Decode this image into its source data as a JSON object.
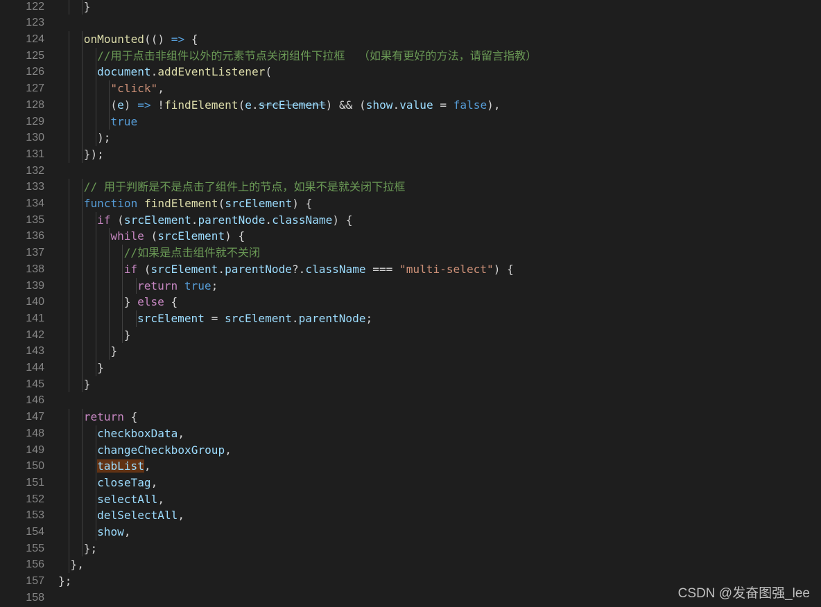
{
  "editor": {
    "watermark": "CSDN @发奋图强_lee",
    "colors": {
      "background": "#1e1e1e",
      "line_number": "#858585",
      "keyword": "#c586c0",
      "storage": "#569cd6",
      "function": "#dcdcaa",
      "variable": "#9cdcfe",
      "string": "#ce9178",
      "comment": "#6a9955",
      "text": "#d4d4d4",
      "highlight": "#613214"
    },
    "lines": [
      {
        "n": "122",
        "indent": 2,
        "tokens": [
          {
            "t": "}",
            "c": "text"
          }
        ]
      },
      {
        "n": "123",
        "indent": 0,
        "tokens": []
      },
      {
        "n": "124",
        "indent": 2,
        "tokens": [
          {
            "t": "onMounted",
            "c": "fn"
          },
          {
            "t": "(() ",
            "c": "text"
          },
          {
            "t": "=>",
            "c": "arrow"
          },
          {
            "t": " {",
            "c": "text"
          }
        ]
      },
      {
        "n": "125",
        "indent": 3,
        "tokens": [
          {
            "t": "//用于点击非组件以外的元素节点关闭组件下拉框  （如果有更好的方法，请留言指教）",
            "c": "cmt"
          }
        ]
      },
      {
        "n": "126",
        "indent": 3,
        "tokens": [
          {
            "t": "document",
            "c": "var"
          },
          {
            "t": ".",
            "c": "text"
          },
          {
            "t": "addEventListener",
            "c": "fn"
          },
          {
            "t": "(",
            "c": "text"
          }
        ]
      },
      {
        "n": "127",
        "indent": 4,
        "tokens": [
          {
            "t": "\"click\"",
            "c": "str"
          },
          {
            "t": ",",
            "c": "text"
          }
        ]
      },
      {
        "n": "128",
        "indent": 4,
        "tokens": [
          {
            "t": "(",
            "c": "text"
          },
          {
            "t": "e",
            "c": "var"
          },
          {
            "t": ") ",
            "c": "text"
          },
          {
            "t": "=>",
            "c": "arrow"
          },
          {
            "t": " !",
            "c": "text"
          },
          {
            "t": "findElement",
            "c": "fn"
          },
          {
            "t": "(",
            "c": "text"
          },
          {
            "t": "e",
            "c": "var"
          },
          {
            "t": ".",
            "c": "text"
          },
          {
            "t": "srcElement",
            "c": "var",
            "deprecated": true
          },
          {
            "t": ") && (",
            "c": "text"
          },
          {
            "t": "show",
            "c": "var"
          },
          {
            "t": ".",
            "c": "text"
          },
          {
            "t": "value",
            "c": "var"
          },
          {
            "t": " = ",
            "c": "text"
          },
          {
            "t": "false",
            "c": "bool"
          },
          {
            "t": "),",
            "c": "text"
          }
        ]
      },
      {
        "n": "129",
        "indent": 4,
        "tokens": [
          {
            "t": "true",
            "c": "bool"
          }
        ]
      },
      {
        "n": "130",
        "indent": 3,
        "tokens": [
          {
            "t": ");",
            "c": "text"
          }
        ]
      },
      {
        "n": "131",
        "indent": 2,
        "tokens": [
          {
            "t": "});",
            "c": "text"
          }
        ]
      },
      {
        "n": "132",
        "indent": 0,
        "tokens": []
      },
      {
        "n": "133",
        "indent": 2,
        "tokens": [
          {
            "t": "// 用于判断是不是点击了组件上的节点，如果不是就关闭下拉框",
            "c": "cmt"
          }
        ]
      },
      {
        "n": "134",
        "indent": 2,
        "tokens": [
          {
            "t": "function",
            "c": "storage"
          },
          {
            "t": " ",
            "c": "text"
          },
          {
            "t": "findElement",
            "c": "fn"
          },
          {
            "t": "(",
            "c": "text"
          },
          {
            "t": "srcElement",
            "c": "var"
          },
          {
            "t": ") {",
            "c": "text"
          }
        ]
      },
      {
        "n": "135",
        "indent": 3,
        "tokens": [
          {
            "t": "if",
            "c": "kw"
          },
          {
            "t": " (",
            "c": "text"
          },
          {
            "t": "srcElement",
            "c": "var"
          },
          {
            "t": ".",
            "c": "text"
          },
          {
            "t": "parentNode",
            "c": "var"
          },
          {
            "t": ".",
            "c": "text"
          },
          {
            "t": "className",
            "c": "var"
          },
          {
            "t": ") {",
            "c": "text"
          }
        ]
      },
      {
        "n": "136",
        "indent": 4,
        "tokens": [
          {
            "t": "while",
            "c": "kw"
          },
          {
            "t": " (",
            "c": "text"
          },
          {
            "t": "srcElement",
            "c": "var"
          },
          {
            "t": ") {",
            "c": "text"
          }
        ]
      },
      {
        "n": "137",
        "indent": 5,
        "tokens": [
          {
            "t": "//如果是点击组件就不关闭",
            "c": "cmt"
          }
        ]
      },
      {
        "n": "138",
        "indent": 5,
        "tokens": [
          {
            "t": "if",
            "c": "kw"
          },
          {
            "t": " (",
            "c": "text"
          },
          {
            "t": "srcElement",
            "c": "var"
          },
          {
            "t": ".",
            "c": "text"
          },
          {
            "t": "parentNode",
            "c": "var"
          },
          {
            "t": "?.",
            "c": "text"
          },
          {
            "t": "className",
            "c": "var"
          },
          {
            "t": " === ",
            "c": "text"
          },
          {
            "t": "\"multi-select\"",
            "c": "str"
          },
          {
            "t": ") {",
            "c": "text"
          }
        ]
      },
      {
        "n": "139",
        "indent": 6,
        "tokens": [
          {
            "t": "return",
            "c": "kw"
          },
          {
            "t": " ",
            "c": "text"
          },
          {
            "t": "true",
            "c": "bool"
          },
          {
            "t": ";",
            "c": "text"
          }
        ]
      },
      {
        "n": "140",
        "indent": 5,
        "tokens": [
          {
            "t": "} ",
            "c": "text"
          },
          {
            "t": "else",
            "c": "kw"
          },
          {
            "t": " {",
            "c": "text"
          }
        ]
      },
      {
        "n": "141",
        "indent": 6,
        "tokens": [
          {
            "t": "srcElement",
            "c": "var"
          },
          {
            "t": " = ",
            "c": "text"
          },
          {
            "t": "srcElement",
            "c": "var"
          },
          {
            "t": ".",
            "c": "text"
          },
          {
            "t": "parentNode",
            "c": "var"
          },
          {
            "t": ";",
            "c": "text"
          }
        ]
      },
      {
        "n": "142",
        "indent": 5,
        "tokens": [
          {
            "t": "}",
            "c": "text"
          }
        ]
      },
      {
        "n": "143",
        "indent": 4,
        "tokens": [
          {
            "t": "}",
            "c": "text"
          }
        ]
      },
      {
        "n": "144",
        "indent": 3,
        "tokens": [
          {
            "t": "}",
            "c": "text"
          }
        ]
      },
      {
        "n": "145",
        "indent": 2,
        "tokens": [
          {
            "t": "}",
            "c": "text"
          }
        ]
      },
      {
        "n": "146",
        "indent": 0,
        "tokens": []
      },
      {
        "n": "147",
        "indent": 2,
        "tokens": [
          {
            "t": "return",
            "c": "kw"
          },
          {
            "t": " {",
            "c": "text"
          }
        ]
      },
      {
        "n": "148",
        "indent": 3,
        "tokens": [
          {
            "t": "checkboxData",
            "c": "var"
          },
          {
            "t": ",",
            "c": "text"
          }
        ]
      },
      {
        "n": "149",
        "indent": 3,
        "tokens": [
          {
            "t": "changeCheckboxGroup",
            "c": "var"
          },
          {
            "t": ",",
            "c": "text"
          }
        ]
      },
      {
        "n": "150",
        "indent": 3,
        "tokens": [
          {
            "t": "tabList",
            "c": "var",
            "hl": true
          },
          {
            "t": ",",
            "c": "text"
          }
        ]
      },
      {
        "n": "151",
        "indent": 3,
        "tokens": [
          {
            "t": "closeTag",
            "c": "var"
          },
          {
            "t": ",",
            "c": "text"
          }
        ]
      },
      {
        "n": "152",
        "indent": 3,
        "tokens": [
          {
            "t": "selectAll",
            "c": "var"
          },
          {
            "t": ",",
            "c": "text"
          }
        ]
      },
      {
        "n": "153",
        "indent": 3,
        "tokens": [
          {
            "t": "delSelectAll",
            "c": "var"
          },
          {
            "t": ",",
            "c": "text"
          }
        ]
      },
      {
        "n": "154",
        "indent": 3,
        "tokens": [
          {
            "t": "show",
            "c": "var"
          },
          {
            "t": ",",
            "c": "text"
          }
        ]
      },
      {
        "n": "155",
        "indent": 2,
        "tokens": [
          {
            "t": "};",
            "c": "text"
          }
        ]
      },
      {
        "n": "156",
        "indent": 1,
        "tokens": [
          {
            "t": "},",
            "c": "text"
          }
        ]
      },
      {
        "n": "157",
        "indent": 0,
        "tokens": [
          {
            "t": "};",
            "c": "text"
          }
        ]
      },
      {
        "n": "158",
        "indent": 0,
        "tokens": []
      }
    ]
  }
}
